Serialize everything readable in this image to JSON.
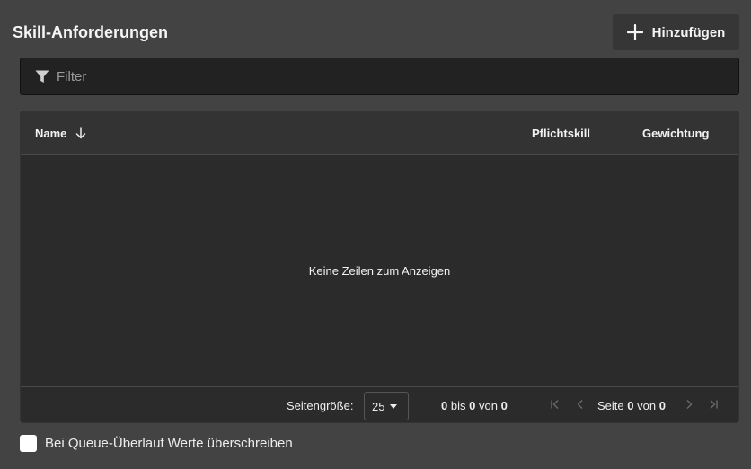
{
  "header": {
    "title": "Skill-Anforderungen",
    "add_button_label": "Hinzufügen",
    "add_icon": "plus-icon"
  },
  "filter": {
    "placeholder": "Filter",
    "value": "",
    "icon": "filter-icon"
  },
  "table": {
    "columns": [
      {
        "label": "Name",
        "sort": "descending"
      },
      {
        "label": "Pflichtskill"
      },
      {
        "label": "Gewichtung"
      }
    ],
    "rows": [],
    "empty_message": "Keine Zeilen zum Anzeigen"
  },
  "pagination": {
    "page_size_label": "Seitengröße:",
    "page_size_value": "25",
    "range_from": "0",
    "range_to_label": "bis",
    "range_to": "0",
    "range_of_label": "von",
    "range_total": "0",
    "page_label": "Seite",
    "page_current": "0",
    "page_of_label": "von",
    "page_total": "0"
  },
  "options": {
    "overwrite_label": "Bei Queue-Überlauf Werte überschreiben",
    "overwrite_checked": false
  },
  "colors": {
    "background": "#434343",
    "grid_background": "#2b2b2b",
    "text": "#f2f2f2"
  }
}
